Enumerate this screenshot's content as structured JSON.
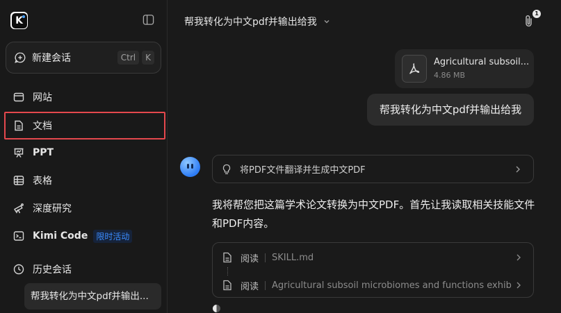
{
  "sidebar": {
    "new_chat": {
      "label": "新建会话",
      "shortcut_keys": [
        "Ctrl",
        "K"
      ]
    },
    "items": [
      {
        "label": "网站",
        "icon": "browser-window-icon"
      },
      {
        "label": "文档",
        "icon": "document-icon",
        "active": true
      },
      {
        "label": "PPT",
        "icon": "presentation-icon"
      },
      {
        "label": "表格",
        "icon": "table-icon"
      },
      {
        "label": "深度研究",
        "icon": "telescope-icon"
      },
      {
        "label": "Kimi Code",
        "icon": "terminal-icon",
        "badge": "限时活动"
      },
      {
        "label": "历史会话",
        "icon": "history-icon"
      }
    ],
    "recent": [
      "帮我转化为中文pdf并输出..."
    ]
  },
  "header": {
    "title": "帮我转化为中文pdf并输出给我",
    "attachment_count": "1"
  },
  "conversation": {
    "file": {
      "name": "Agricultural subsoil...",
      "size": "4.86 MB",
      "icon": "pdf-icon"
    },
    "user_message": "帮我转化为中文pdf并输出给我",
    "thought_summary": "将PDF文件翻译并生成中文PDF",
    "assistant_reply": "我将帮您把这篇学术论文转换为中文PDF。首先让我读取相关技能文件和PDF内容。",
    "tool_calls": [
      {
        "verb": "阅读",
        "arg": "SKILL.md"
      },
      {
        "verb": "阅读",
        "arg": "Agricultural subsoil microbiomes and functions exhib..."
      }
    ]
  },
  "colors": {
    "background": "#1a1a1a",
    "active_outline": "#e5484d",
    "badge_blue": "#3b8cff"
  }
}
